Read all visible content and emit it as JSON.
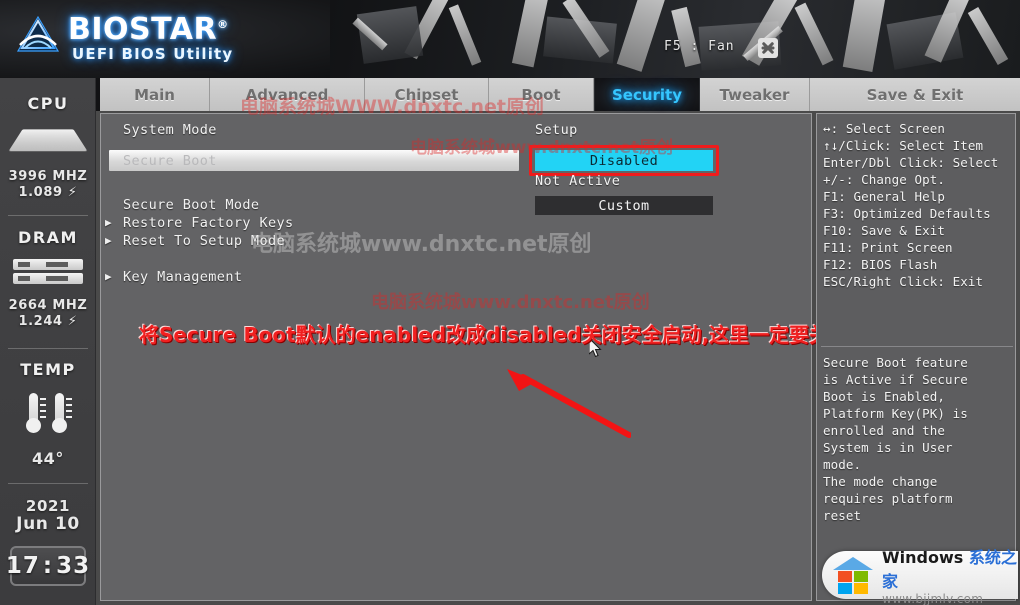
{
  "app": {
    "brand": "BIOSTAR",
    "brand_reg": "®",
    "subtitle": "UEFI BIOS Utility",
    "fan_hint": "F5 : Fan",
    "fan_icon": "fan-icon"
  },
  "tabs": [
    {
      "label": "Main",
      "active": false
    },
    {
      "label": "Advanced",
      "active": false
    },
    {
      "label": "Chipset",
      "active": false
    },
    {
      "label": "Boot",
      "active": false
    },
    {
      "label": "Security",
      "active": true
    },
    {
      "label": "Tweaker",
      "active": false
    },
    {
      "label": "Save & Exit",
      "active": false
    }
  ],
  "sidebar": {
    "cpu": {
      "title": "CPU",
      "freq": "3996 MHZ",
      "volt": "1.089 ⚡"
    },
    "dram": {
      "title": "DRAM",
      "freq": "2664 MHZ",
      "volt": "1.244 ⚡"
    },
    "temp": {
      "title": "TEMP",
      "value": "44°"
    },
    "clock": {
      "year": "2021",
      "date": "Jun 10",
      "hours": "17",
      "minutes": "33"
    }
  },
  "main": {
    "system_mode_label": "System Mode",
    "system_mode_value": "Setup",
    "secure_boot_label": "Secure Boot",
    "secure_boot_value": "Disabled",
    "secure_boot_state": "Not Active",
    "secure_boot_mode_label": "Secure Boot Mode",
    "secure_boot_mode_value": "Custom",
    "restore_factory_keys": "Restore Factory Keys",
    "reset_to_setup_mode": "Reset To Setup Mode",
    "key_management": "Key Management",
    "annotation": "将Secure Boot默认的enabled改成disabled关闭安全启动,这里一定要关闭"
  },
  "help": {
    "keys": [
      "↔: Select Screen",
      "↑↓/Click: Select Item",
      "Enter/Dbl Click: Select",
      "+/-: Change Opt.",
      "F1: General Help",
      "F3: Optimized Defaults",
      "F10: Save & Exit",
      "F11: Print Screen",
      "F12: BIOS Flash",
      "ESC/Right Click: Exit"
    ],
    "description": [
      "Secure Boot feature",
      "is Active if Secure",
      "Boot is Enabled,",
      "Platform Key(PK) is",
      "enrolled and the",
      "System is in User",
      "mode.",
      "The mode change",
      "requires platform",
      "reset"
    ]
  },
  "watermarks": {
    "red_top": "电脑系统城WWW.dnxtc.net原创",
    "red_mid": "电脑系统城www.dnxtc.net原创",
    "red_low": "电脑系统城www.dnxtc.net原创",
    "grey_mid": "电脑系统城www.dnxtc.net原创"
  },
  "footer_logo": {
    "title_en": "Windows",
    "title_cn": "系统之家",
    "url": "www.bjjmlv.com"
  },
  "colors": {
    "accent_cyan": "#22d3f5",
    "tab_active": "#35c6ff",
    "annotation_red": "#f02020",
    "panel_bg": "#636365"
  }
}
